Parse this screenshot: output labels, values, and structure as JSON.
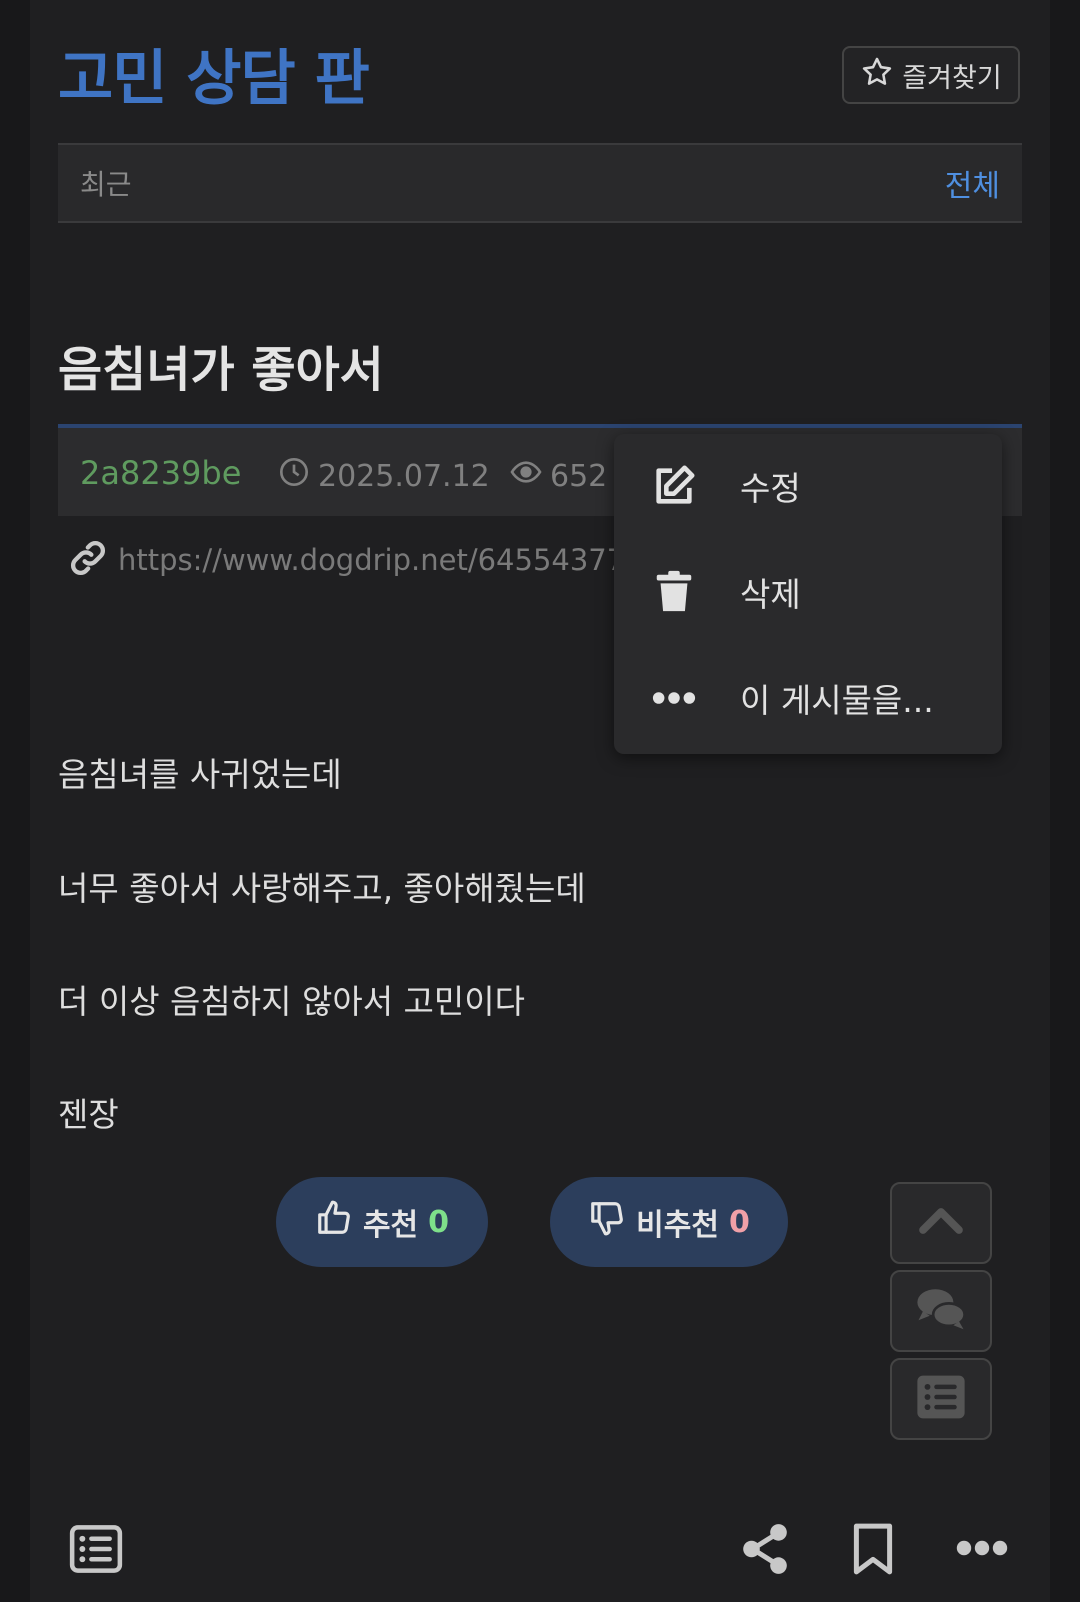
{
  "header": {
    "board_title": "고민 상담 판",
    "favorite_label": "즐겨찾기"
  },
  "tabs": {
    "recent": "최근",
    "all": "전체"
  },
  "post": {
    "title": "음침녀가 좋아서",
    "author": "2a8239be",
    "date": "2025.07.12",
    "views": "652",
    "url": "https://www.dogdrip.net/645543775",
    "body": [
      "음침녀를 사귀었는데",
      "너무 좋아서 사랑해주고, 좋아해줬는데",
      "더 이상 음침하지 않아서 고민이다",
      "젠장"
    ]
  },
  "votes": {
    "up_label": "추천",
    "up_count": "0",
    "down_label": "비추천",
    "down_count": "0"
  },
  "context_menu": {
    "items": [
      {
        "label": "수정",
        "icon": "edit-icon"
      },
      {
        "label": "삭제",
        "icon": "trash-icon"
      },
      {
        "label": "이 게시물을...",
        "icon": "more-dots-icon"
      }
    ]
  },
  "floating": {
    "icons": [
      "chevron-up-icon",
      "comments-icon",
      "list-icon"
    ]
  },
  "bottom_bar": {
    "icons": [
      "list-icon",
      "share-icon",
      "bookmark-icon",
      "more-icon"
    ]
  },
  "colors": {
    "accent": "#3f74c4",
    "author": "#5f9b5f",
    "up_count": "#7ee08a",
    "down_count": "#f0a0a8",
    "vote_bg": "#2c3e5c"
  }
}
